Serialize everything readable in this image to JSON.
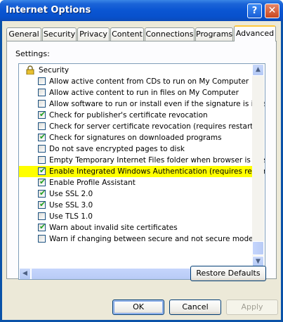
{
  "window": {
    "title": "Internet Options",
    "help_glyph": "?",
    "close_glyph": "✕"
  },
  "tabs": [
    "General",
    "Security",
    "Privacy",
    "Content",
    "Connections",
    "Programs",
    "Advanced"
  ],
  "active_tab": "Advanced",
  "settings_label": "Settings:",
  "section": {
    "label": "Security",
    "icon": "lock-icon"
  },
  "options": [
    {
      "label": "Allow active content from CDs to run on My Computer",
      "checked": false
    },
    {
      "label": "Allow active content to run in files on My Computer",
      "checked": false
    },
    {
      "label": "Allow software to run or install even if the signature is invalid",
      "checked": false
    },
    {
      "label": "Check for publisher's certificate revocation",
      "checked": true
    },
    {
      "label": "Check for server certificate revocation (requires restart)",
      "checked": false
    },
    {
      "label": "Check for signatures on downloaded programs",
      "checked": true
    },
    {
      "label": "Do not save encrypted pages to disk",
      "checked": false
    },
    {
      "label": "Empty Temporary Internet Files folder when browser is closed",
      "checked": false
    },
    {
      "label": "Enable Integrated Windows Authentication (requires restart)",
      "checked": true,
      "highlighted": true
    },
    {
      "label": "Enable Profile Assistant",
      "checked": true
    },
    {
      "label": "Use SSL 2.0",
      "checked": true
    },
    {
      "label": "Use SSL 3.0",
      "checked": true
    },
    {
      "label": "Use TLS 1.0",
      "checked": false
    },
    {
      "label": "Warn about invalid site certificates",
      "checked": true
    },
    {
      "label": "Warn if changing between secure and not secure mode",
      "checked": false
    }
  ],
  "buttons": {
    "restore_defaults": "Restore Defaults",
    "ok": "OK",
    "cancel": "Cancel",
    "apply": "Apply"
  },
  "colors": {
    "highlight": "#ffff00",
    "check": "#21a121",
    "title_bar": "#0a55d2"
  }
}
